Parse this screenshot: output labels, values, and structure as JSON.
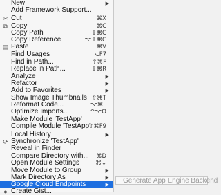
{
  "menu": {
    "items": [
      {
        "label": "New",
        "submenu": true
      },
      {
        "label": "Add Framework Support..."
      },
      {
        "label": "Cut",
        "shortcut": "⌘X",
        "icon": "cut-icon",
        "glyph": "✂"
      },
      {
        "label": "Copy",
        "shortcut": "⌘C",
        "icon": "copy-icon",
        "glyph": "⧉"
      },
      {
        "label": "Copy Path",
        "shortcut": "⇧⌘C"
      },
      {
        "label": "Copy Reference",
        "shortcut": "⌥⇧⌘C"
      },
      {
        "label": "Paste",
        "shortcut": "⌘V",
        "icon": "paste-icon",
        "glyph": "▤"
      },
      {
        "label": "Find Usages",
        "shortcut": "⌥F7"
      },
      {
        "label": "Find in Path...",
        "shortcut": "⇧⌘F"
      },
      {
        "label": "Replace in Path...",
        "shortcut": "⇧⌘R"
      },
      {
        "label": "Analyze",
        "submenu": true
      },
      {
        "label": "Refactor",
        "submenu": true
      },
      {
        "label": "Add to Favorites",
        "submenu": true
      },
      {
        "label": "Show Image Thumbnails",
        "shortcut": "⇧⌘T"
      },
      {
        "label": "Reformat Code...",
        "shortcut": "⌥⌘L"
      },
      {
        "label": "Optimize Imports...",
        "shortcut": "^⌥O"
      },
      {
        "label": "Make Module 'TestApp'"
      },
      {
        "label": "Compile Module 'TestApp'",
        "shortcut": "⇧⌘F9"
      },
      {
        "label": "Local History",
        "submenu": true
      },
      {
        "label": "Synchronize 'TestApp'",
        "icon": "sync-icon",
        "glyph": "⟳"
      },
      {
        "label": "Reveal in Finder"
      },
      {
        "label": "Compare Directory with...",
        "shortcut": "⌘D"
      },
      {
        "label": "Open Module Settings",
        "shortcut": "⌘↓"
      },
      {
        "label": "Move Module to Group",
        "submenu": true
      },
      {
        "label": "Mark Directory As",
        "submenu": true
      },
      {
        "label": "Google Cloud Endpoints",
        "submenu": true,
        "highlighted": true
      },
      {
        "label": "Create Gist...",
        "icon": "github-icon",
        "glyph": "●"
      }
    ]
  },
  "submenu": {
    "label": "Generate App Engine Backend"
  },
  "colors": {
    "highlight": "#1e6fe0",
    "disabled_text": "#9a9a9a"
  }
}
